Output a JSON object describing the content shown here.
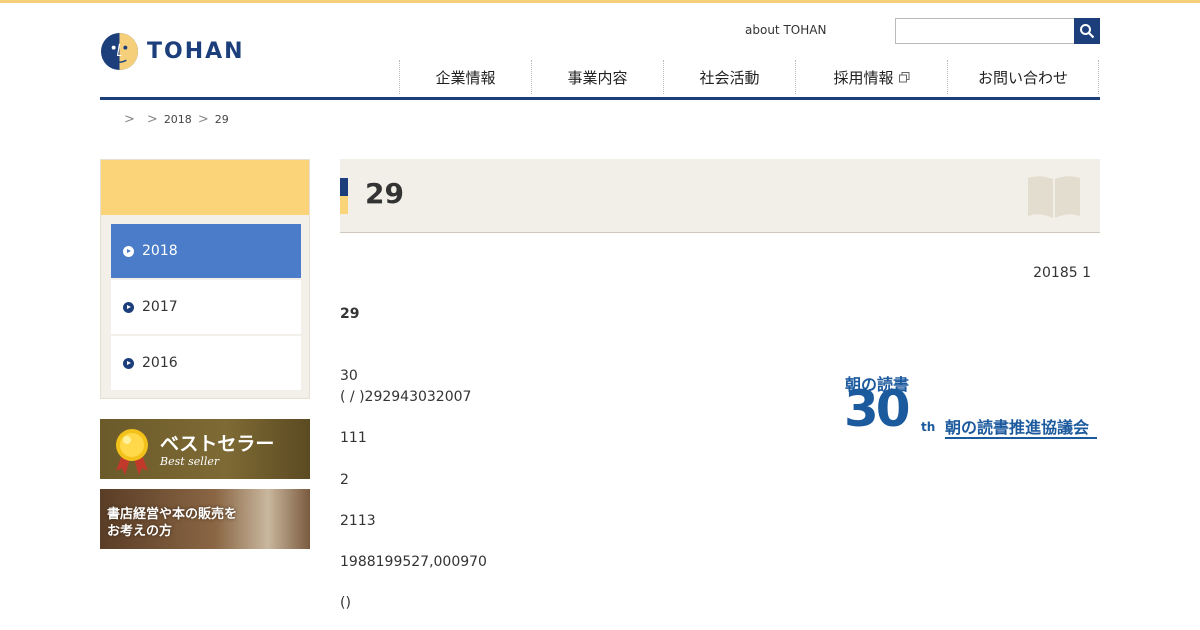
{
  "header": {
    "logo_text": "TOHAN",
    "about_link": "about TOHAN",
    "search_placeholder": ""
  },
  "nav": {
    "items": [
      {
        "label": "企業情報",
        "width": 132
      },
      {
        "label": "事業内容",
        "width": 132
      },
      {
        "label": "社会活動",
        "width": 132
      },
      {
        "label": "採用情報",
        "width": 152,
        "external": true
      },
      {
        "label": "お問い合わせ",
        "width": 152
      }
    ]
  },
  "breadcrumb": {
    "items": [
      "",
      "2018",
      "29"
    ]
  },
  "sidebar": {
    "years": [
      {
        "label": "2018",
        "active": true
      },
      {
        "label": "2017",
        "active": false
      },
      {
        "label": "2016",
        "active": false
      }
    ],
    "banner_best": {
      "title": "ベストセラー",
      "subtitle": "Best seller"
    },
    "banner_shop": {
      "line1": "書店経営や本の販売を",
      "line2": "お考えの方"
    }
  },
  "article": {
    "title": "29",
    "date": "20185 1",
    "subtitle": "29",
    "lines": [
      "30",
      "( / )292943032007",
      "111",
      "2",
      "2113",
      "1988199527,000970",
      "()"
    ]
  },
  "promo": {
    "top_text": "朝の読書",
    "number": "30",
    "suffix": "th",
    "org_name": "朝の読書推進協議会"
  },
  "colors": {
    "brand_navy": "#1c3f7c",
    "accent_yellow": "#fbd47a",
    "active_blue": "#4a7cc9",
    "panel_beige": "#f2efe9"
  }
}
